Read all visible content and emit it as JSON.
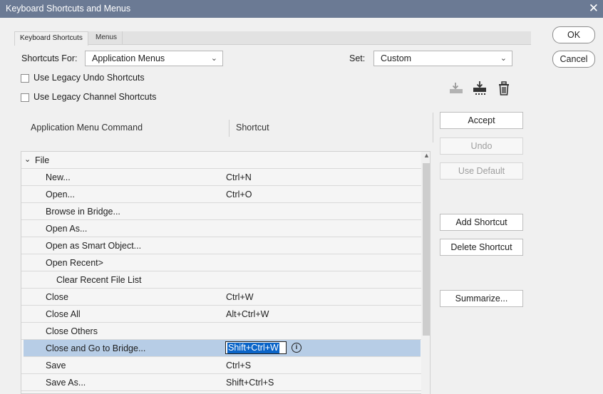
{
  "window": {
    "title": "Keyboard Shortcuts and Menus",
    "close_glyph": "✕"
  },
  "tabs": [
    {
      "label": "Keyboard Shortcuts"
    },
    {
      "label": "Menus"
    }
  ],
  "shortcuts_for": {
    "label": "Shortcuts For:",
    "value": "Application Menus"
  },
  "set": {
    "label": "Set:",
    "value": "Custom"
  },
  "checkboxes": {
    "legacy_undo": {
      "label": "Use Legacy Undo Shortcuts",
      "checked": false
    },
    "legacy_channel": {
      "label": "Use Legacy Channel Shortcuts",
      "checked": false
    }
  },
  "columns": {
    "command": "Application Menu Command",
    "shortcut": "Shortcut"
  },
  "group": {
    "label": "File",
    "expanded": true
  },
  "rows": [
    {
      "command": "New...",
      "shortcut": "Ctrl+N"
    },
    {
      "command": "Open...",
      "shortcut": "Ctrl+O"
    },
    {
      "command": "Browse in Bridge...",
      "shortcut": ""
    },
    {
      "command": "Open As...",
      "shortcut": ""
    },
    {
      "command": "Open as Smart Object...",
      "shortcut": ""
    },
    {
      "command": "Open Recent>",
      "shortcut": ""
    },
    {
      "command": "Clear Recent File List",
      "shortcut": ""
    },
    {
      "command": "Close",
      "shortcut": "Ctrl+W"
    },
    {
      "command": "Close All",
      "shortcut": "Alt+Ctrl+W"
    },
    {
      "command": "Close Others",
      "shortcut": ""
    },
    {
      "command": "Close and Go to Bridge...",
      "shortcut": "Shift+Ctrl+W",
      "selected": true,
      "info": "i"
    },
    {
      "command": "Save",
      "shortcut": "Ctrl+S"
    },
    {
      "command": "Save As...",
      "shortcut": "Shift+Ctrl+S"
    }
  ],
  "buttons": {
    "ok": "OK",
    "cancel": "Cancel",
    "accept": "Accept",
    "undo": "Undo",
    "use_default": "Use Default",
    "add_shortcut": "Add Shortcut",
    "delete_shortcut": "Delete Shortcut",
    "summarize": "Summarize..."
  },
  "icons": [
    "save-set-icon",
    "save-set-as-icon",
    "delete-set-icon"
  ],
  "colors": {
    "titlebar": "#6b7a94",
    "selected_row": "#b7cde6",
    "text_selection": "#0a64c8"
  }
}
